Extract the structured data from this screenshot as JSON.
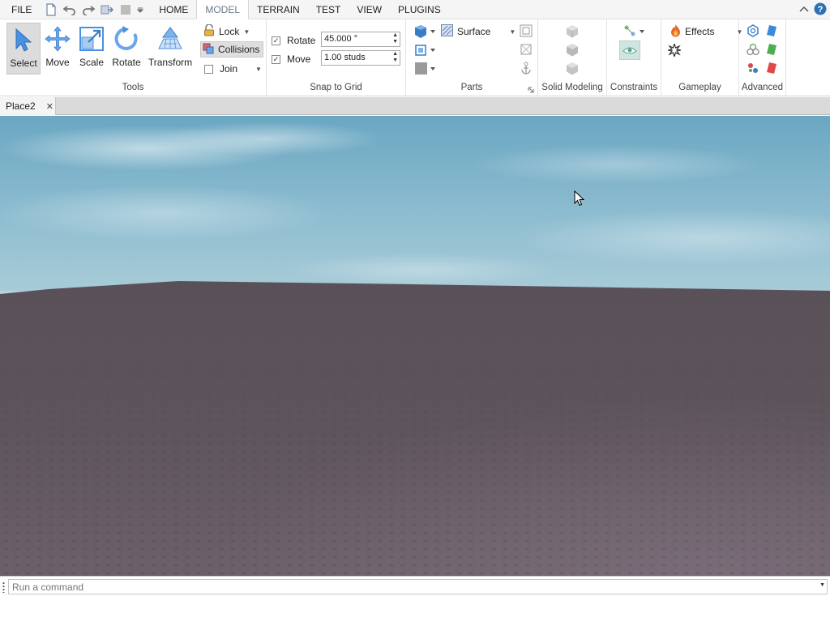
{
  "menubar": {
    "file_label": "FILE",
    "tabs": [
      {
        "label": "HOME",
        "active": false
      },
      {
        "label": "MODEL",
        "active": true
      },
      {
        "label": "TERRAIN",
        "active": false
      },
      {
        "label": "TEST",
        "active": false
      },
      {
        "label": "VIEW",
        "active": false
      },
      {
        "label": "PLUGINS",
        "active": false
      }
    ]
  },
  "ribbon": {
    "tools": {
      "group_label": "Tools",
      "select_label": "Select",
      "move_label": "Move",
      "scale_label": "Scale",
      "rotate_label": "Rotate",
      "transform_label": "Transform",
      "lock_label": "Lock",
      "collisions_label": "Collisions",
      "join_label": "Join"
    },
    "snap": {
      "group_label": "Snap to Grid",
      "rotate_label": "Rotate",
      "rotate_checked": true,
      "rotate_value": "45.000 °",
      "move_label": "Move",
      "move_checked": true,
      "move_value": "1.00 studs"
    },
    "parts": {
      "group_label": "Parts",
      "surface_label": "Surface"
    },
    "solid_modeling": {
      "group_label": "Solid Modeling"
    },
    "constraints": {
      "group_label": "Constraints"
    },
    "gameplay": {
      "group_label": "Gameplay",
      "effects_label": "Effects"
    },
    "advanced": {
      "group_label": "Advanced"
    }
  },
  "document": {
    "tab_title": "Place2"
  },
  "command_bar": {
    "placeholder": "Run a command"
  },
  "colors": {
    "accent": "#3b8bd8",
    "sky": "#8ebdd0",
    "baseplate": "#5b5258"
  }
}
